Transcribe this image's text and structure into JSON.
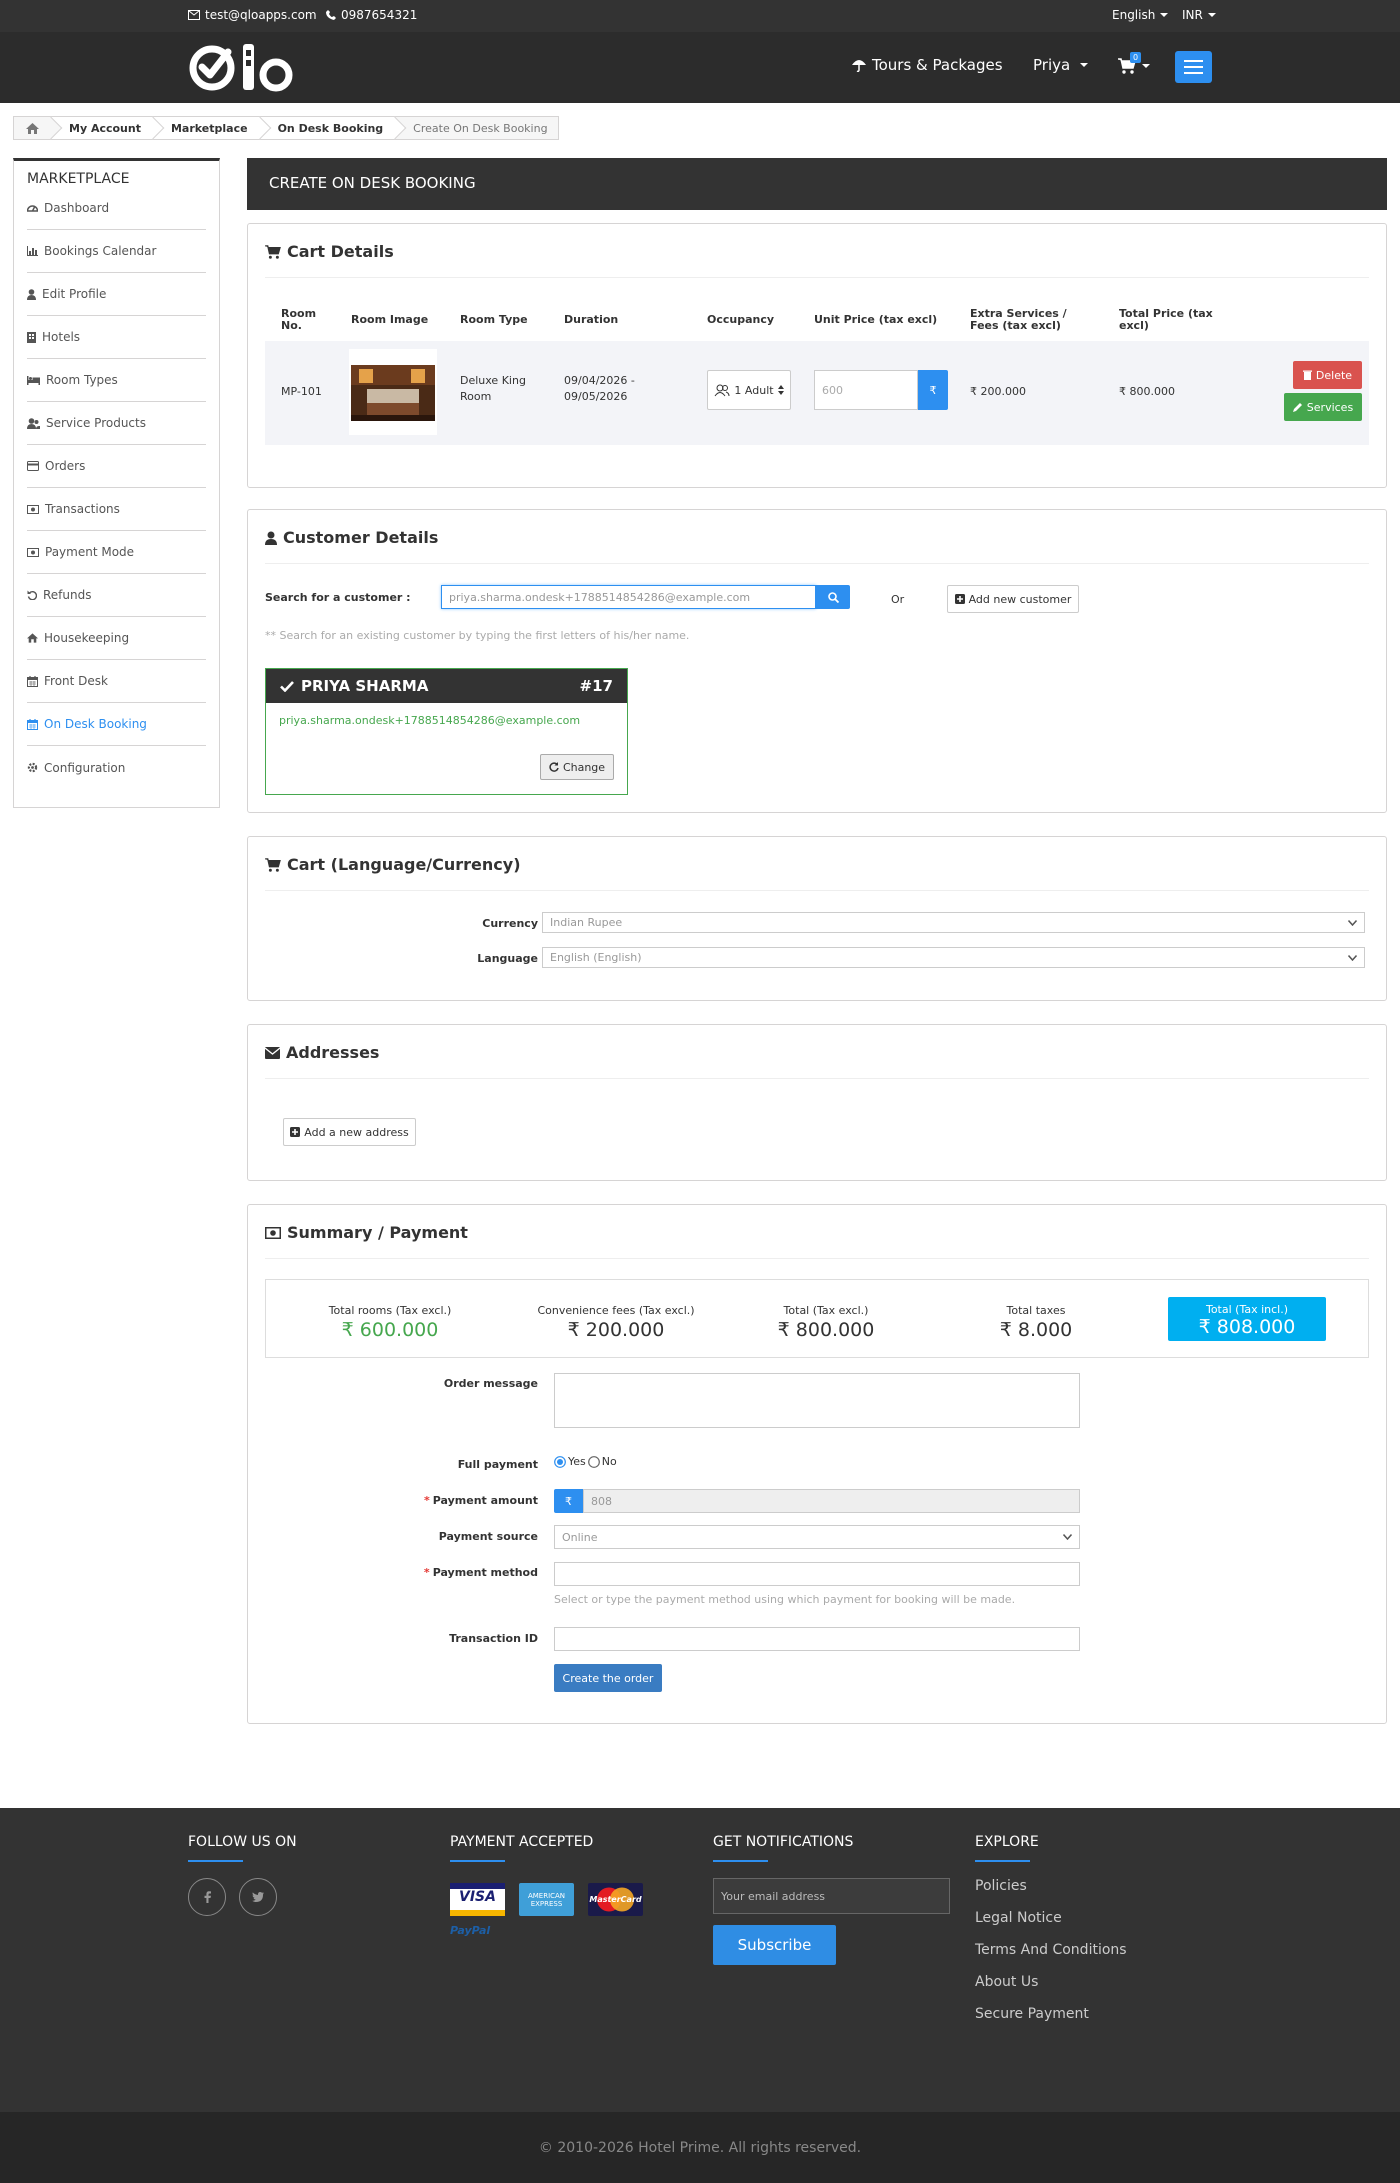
{
  "topbar": {
    "email": "test@qloapps.com",
    "phone": "0987654321",
    "language": "English",
    "currency": "INR"
  },
  "header": {
    "tours_label": "Tours & Packages",
    "user_label": "Priya",
    "cart_count": "0"
  },
  "breadcrumb": {
    "items": [
      "My Account",
      "Marketplace",
      "On Desk Booking"
    ],
    "current": "Create On Desk Booking"
  },
  "sidebar": {
    "title": "MARKETPLACE",
    "items": [
      {
        "label": "Dashboard",
        "icon": "dashboard-icon"
      },
      {
        "label": "Bookings Calendar",
        "icon": "bar-chart-icon"
      },
      {
        "label": "Edit Profile",
        "icon": "user-icon"
      },
      {
        "label": "Hotels",
        "icon": "building-icon"
      },
      {
        "label": "Room Types",
        "icon": "bed-icon"
      },
      {
        "label": "Service Products",
        "icon": "users-icon"
      },
      {
        "label": "Orders",
        "icon": "credit-card-icon"
      },
      {
        "label": "Transactions",
        "icon": "money-icon"
      },
      {
        "label": "Payment Mode",
        "icon": "money-icon"
      },
      {
        "label": "Refunds",
        "icon": "undo-icon"
      },
      {
        "label": "Housekeeping",
        "icon": "home-icon"
      },
      {
        "label": "Front Desk",
        "icon": "calendar-icon"
      },
      {
        "label": "On Desk Booking",
        "icon": "calendar-icon",
        "active": true
      },
      {
        "label": "Configuration",
        "icon": "gear-icon"
      }
    ]
  },
  "page": {
    "heading": "CREATE ON DESK BOOKING"
  },
  "cart": {
    "title": "Cart Details",
    "columns": {
      "room_no": "Room No.",
      "room_image": "Room Image",
      "room_type": "Room Type",
      "duration": "Duration",
      "occupancy": "Occupancy",
      "unit_price": "Unit Price (tax excl)",
      "extra": "Extra Services / Fees (tax excl)",
      "total": "Total Price (tax excl)"
    },
    "row": {
      "room_no": "MP-101",
      "room_type": "Deluxe King Room",
      "duration": "09/04/2026 - 09/05/2026",
      "occupancy": "1 Adult",
      "unit_price": "600",
      "currency_symbol": "₹",
      "extra": "₹ 200.000",
      "total": "₹ 800.000",
      "delete_label": "Delete",
      "services_label": "Services"
    }
  },
  "customer": {
    "title": "Customer Details",
    "search_label": "Search for a customer :",
    "search_value": "priya.sharma.ondesk+1788514854286@example.com",
    "or_label": "Or",
    "add_new_label": "Add new customer",
    "hint": "** Search for an existing customer by typing the first letters of his/her name.",
    "selected": {
      "name": "PRIYA SHARMA",
      "id": "#17",
      "email": "priya.sharma.ondesk+1788514854286@example.com",
      "change_label": "Change"
    }
  },
  "cart_lang": {
    "title": "Cart (Language/Currency)",
    "currency_label": "Currency",
    "currency_value": "Indian Rupee",
    "language_label": "Language",
    "language_value": "English (English)"
  },
  "addresses": {
    "title": "Addresses",
    "add_label": "Add a new address"
  },
  "summary": {
    "title": "Summary / Payment",
    "total_rooms_label": "Total rooms (Tax excl.)",
    "total_rooms_value": "₹ 600.000",
    "conv_fees_label": "Convenience fees (Tax excl.)",
    "conv_fees_value": "₹ 200.000",
    "total_excl_label": "Total (Tax excl.)",
    "total_excl_value": "₹ 800.000",
    "taxes_label": "Total taxes",
    "taxes_value": "₹ 8.000",
    "total_incl_label": "Total (Tax incl.)",
    "total_incl_value": "₹ 808.000",
    "order_message_label": "Order message",
    "full_payment_label": "Full payment",
    "yes_label": "Yes",
    "no_label": "No",
    "payment_amount_label": "Payment amount",
    "payment_amount_value": "808",
    "payment_source_label": "Payment source",
    "payment_source_value": "Online",
    "payment_method_label": "Payment method",
    "payment_method_hint": "Select or type the payment method using which payment for booking will be made.",
    "transaction_id_label": "Transaction ID",
    "create_label": "Create the order"
  },
  "footer": {
    "follow_title": "FOLLOW US ON",
    "payment_title": "PAYMENT ACCEPTED",
    "notify_title": "GET NOTIFICATIONS",
    "email_placeholder": "Your email address",
    "subscribe_label": "Subscribe",
    "explore_title": "EXPLORE",
    "explore_links": [
      "Policies",
      "Legal Notice",
      "Terms And Conditions",
      "About Us",
      "Secure Payment"
    ],
    "cards": {
      "visa": "VISA",
      "amex": "AMERICAN EXPRESS",
      "mastercard": "MasterCard",
      "paypal": "PayPal"
    },
    "copyright": "© 2010-2026  Hotel Prime.  All rights reserved."
  },
  "colors": {
    "accent": "#2d8ff0",
    "dark": "#333333",
    "danger": "#d9534f",
    "success": "#46a74e",
    "total_highlight": "#00aff0"
  }
}
